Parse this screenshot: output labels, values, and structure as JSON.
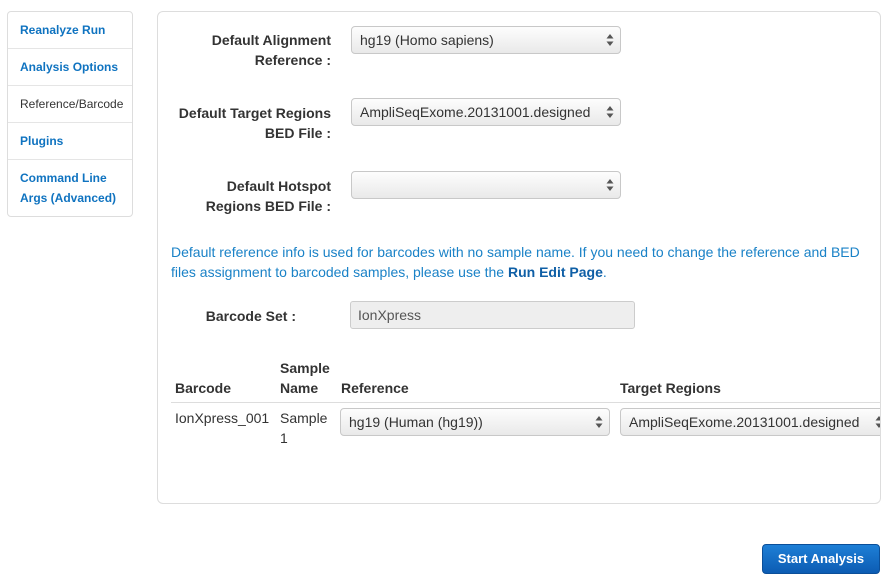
{
  "sidebar": {
    "items": [
      {
        "label": "Reanalyze Run"
      },
      {
        "label": "Analysis Options"
      },
      {
        "label": "Reference/Barcode"
      },
      {
        "label": "Plugins"
      },
      {
        "label": "Command Line Args (Advanced)"
      }
    ]
  },
  "form": {
    "alignment": {
      "label_line1": "Default Alignment",
      "label_line2": "Reference :",
      "value": "hg19 (Homo sapiens)"
    },
    "target_regions": {
      "label_line1": "Default Target Regions",
      "label_line2": "BED File :",
      "value": "AmpliSeqExome.20131001.designed"
    },
    "hotspot": {
      "label_line1": "Default Hotspot",
      "label_line2": "Regions BED File :",
      "value": ""
    },
    "info": {
      "text": "Default reference info is used for barcodes with no sample name. If you need to change the reference and BED files assignment to barcoded samples, please use the ",
      "link": "Run Edit Page",
      "suffix": "."
    },
    "barcode_set": {
      "label": "Barcode Set :",
      "value": "IonXpress"
    }
  },
  "table": {
    "headers": {
      "barcode": "Barcode",
      "sample_line1": "Sample",
      "sample_line2": "Name",
      "reference": "Reference",
      "target_regions": "Target Regions"
    },
    "rows": [
      {
        "barcode": "IonXpress_001",
        "sample_line1": "Sample",
        "sample_line2": "1",
        "reference": "hg19 (Human (hg19))",
        "target_regions": "AmpliSeqExome.20131001.designed"
      }
    ]
  },
  "actions": {
    "start_label": "Start Analysis"
  }
}
